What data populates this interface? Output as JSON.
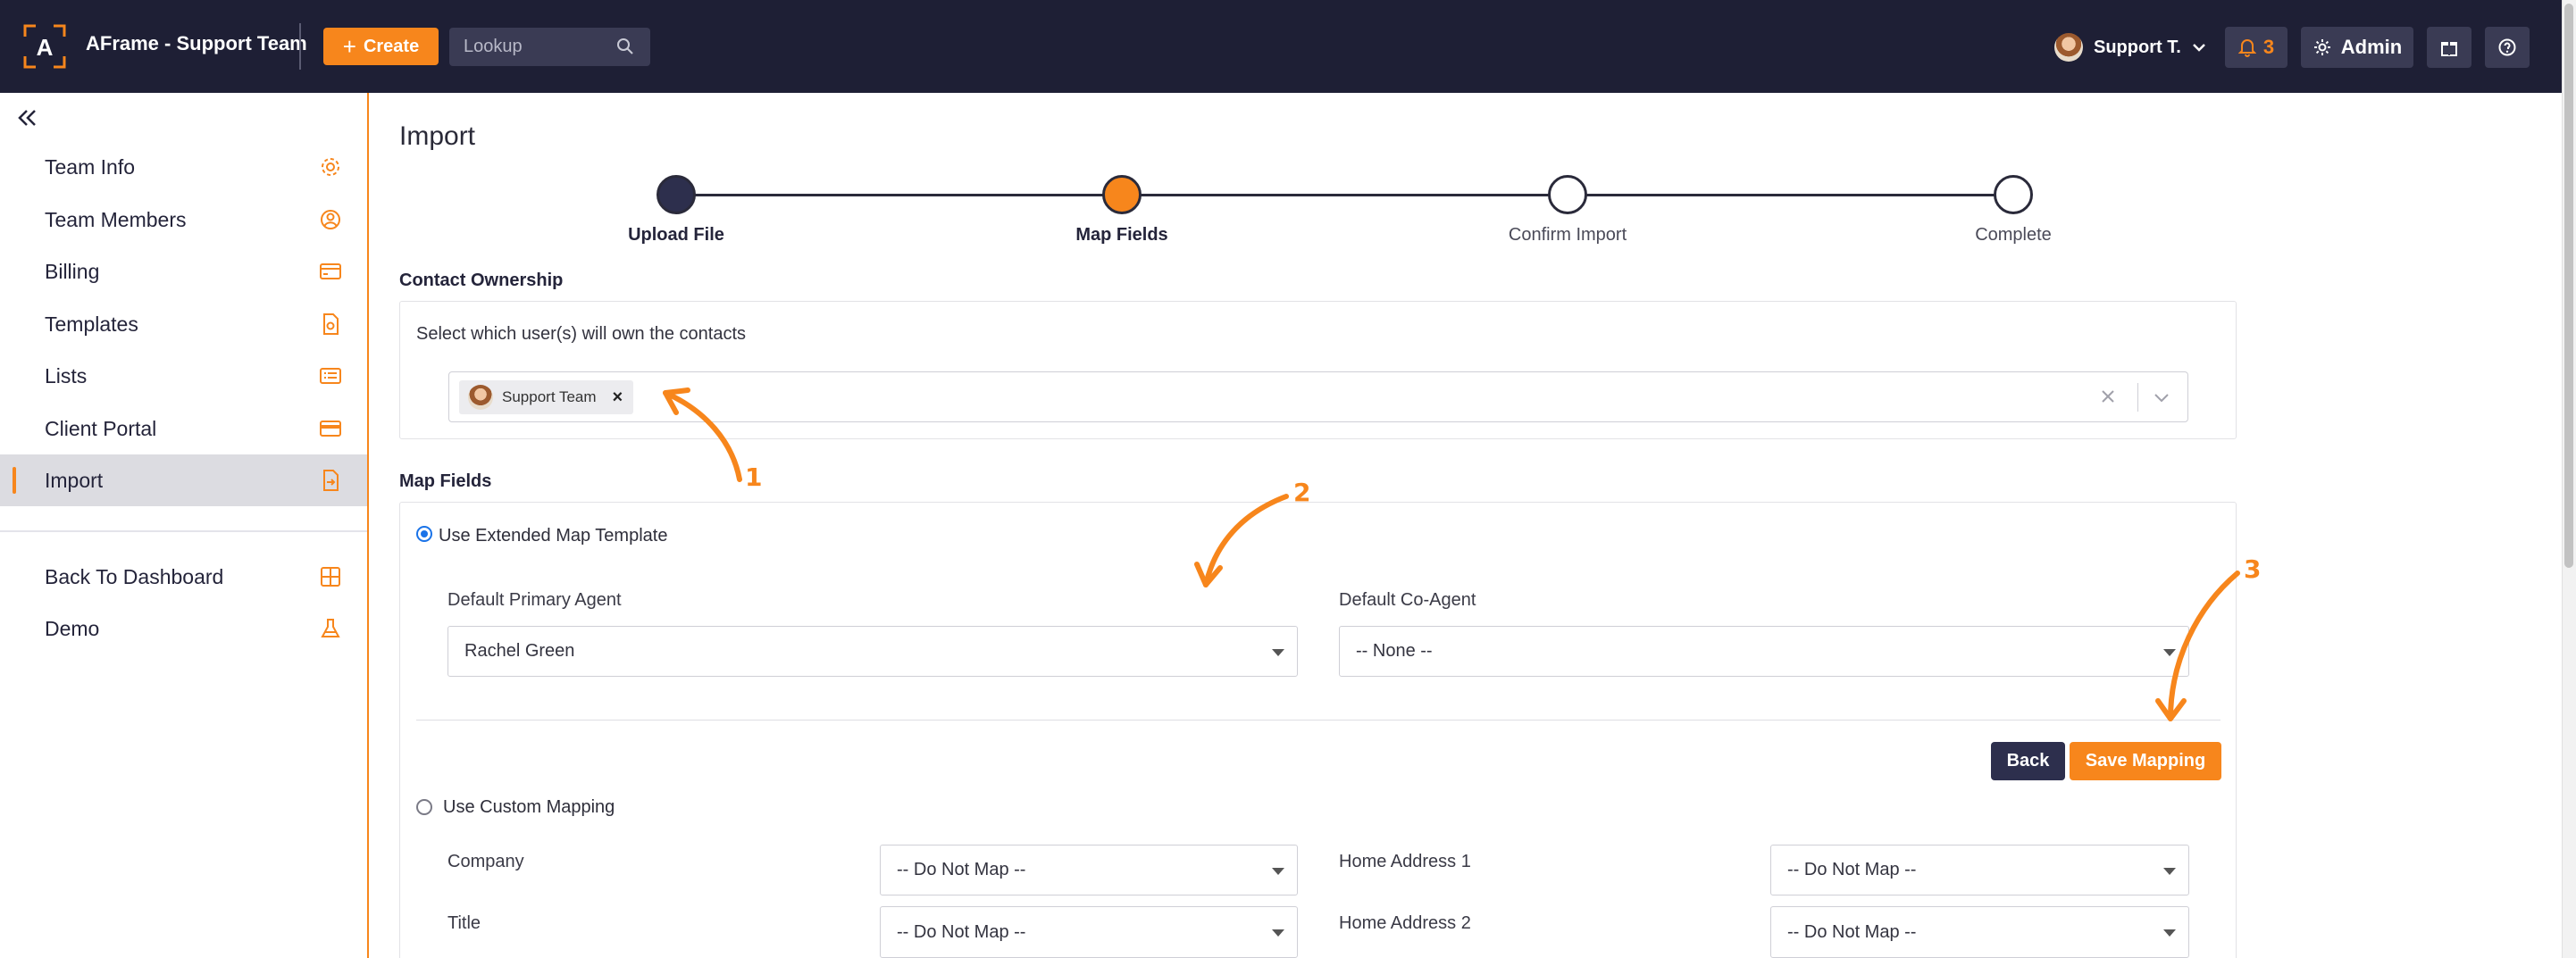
{
  "app": {
    "title": "AFrame - Support Team",
    "logo_letter": "A"
  },
  "topbar": {
    "create_label": "Create",
    "lookup_placeholder": "Lookup",
    "user_name": "Support T.",
    "notification_count": "3",
    "admin_label": "Admin"
  },
  "sidebar": {
    "items": [
      {
        "label": "Team Info",
        "icon": "gear-icon"
      },
      {
        "label": "Team Members",
        "icon": "user-circle-icon"
      },
      {
        "label": "Billing",
        "icon": "credit-card-icon"
      },
      {
        "label": "Templates",
        "icon": "document-icon"
      },
      {
        "label": "Lists",
        "icon": "list-icon"
      },
      {
        "label": "Client Portal",
        "icon": "card-icon"
      },
      {
        "label": "Import",
        "icon": "import-file-icon",
        "active": true
      }
    ],
    "bottom_items": [
      {
        "label": "Back To Dashboard",
        "icon": "grid-icon"
      },
      {
        "label": "Demo",
        "icon": "flask-icon"
      }
    ]
  },
  "main": {
    "title": "Import",
    "steps": [
      {
        "label": "Upload File",
        "state": "done"
      },
      {
        "label": "Map Fields",
        "state": "current"
      },
      {
        "label": "Confirm Import",
        "state": "todo"
      },
      {
        "label": "Complete",
        "state": "todo"
      }
    ],
    "contact_ownership": {
      "title": "Contact Ownership",
      "instruction": "Select which user(s) will own the contacts",
      "selected_owner": "Support Team"
    },
    "map_fields": {
      "title": "Map Fields",
      "extended_option_label": "Use Extended Map Template",
      "primary_agent_label": "Default Primary Agent",
      "primary_agent_value": "Rachel Green",
      "co_agent_label": "Default Co-Agent",
      "co_agent_value": "-- None --",
      "back_label": "Back",
      "save_label": "Save Mapping",
      "custom_option_label": "Use Custom Mapping",
      "custom_fields": [
        {
          "label": "Company",
          "value": "-- Do Not Map --"
        },
        {
          "label": "Home Address 1",
          "value": "-- Do Not Map --"
        },
        {
          "label": "Title",
          "value": "-- Do Not Map --"
        },
        {
          "label": "Home Address 2",
          "value": "-- Do Not Map --"
        }
      ]
    }
  },
  "annotations": [
    "1",
    "2",
    "3"
  ],
  "colors": {
    "accent": "#f7861c",
    "navy": "#1e1f35",
    "button_dark": "#2d2f4d"
  }
}
